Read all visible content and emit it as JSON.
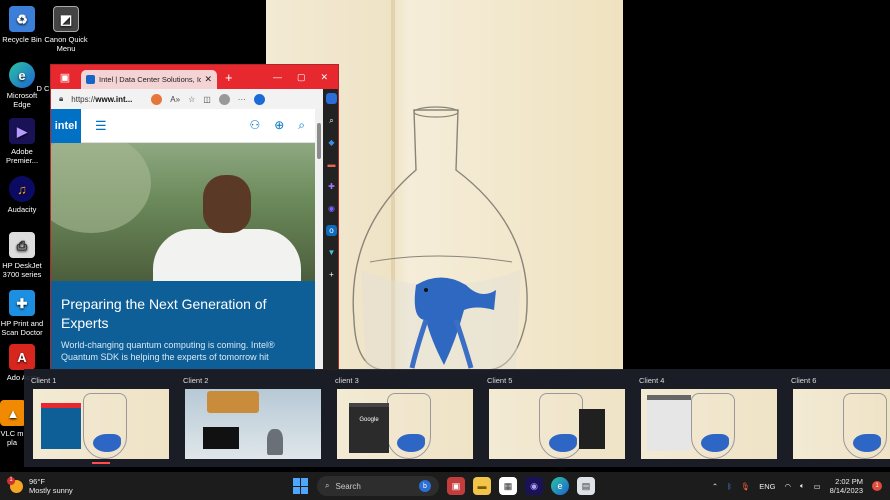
{
  "desktop": {
    "icons": [
      {
        "label": "Recycle Bin",
        "icon": "recycle-bin-icon"
      },
      {
        "label": "Canon Quick Menu",
        "icon": "canon-icon"
      },
      {
        "label": "Microsoft Edge",
        "icon": "edge-icon"
      },
      {
        "label": "Adobe Premier...",
        "icon": "premiere-icon"
      },
      {
        "label": "Audacity",
        "icon": "audacity-icon"
      },
      {
        "label": "HP DeskJet 3700 series",
        "icon": "printer-icon"
      },
      {
        "label": "HP Print and Scan Doctor",
        "icon": "hp-doctor-icon"
      },
      {
        "label": "Ado Acro",
        "icon": "acrobat-icon"
      },
      {
        "label": "VLC m pla",
        "icon": "vlc-icon"
      },
      {
        "label": "D C",
        "icon": "partial-icon"
      }
    ]
  },
  "browser": {
    "tab_title": "Intel | Data Center Solutions, IoT",
    "url_prefix": "https://",
    "url_host": "www.int...",
    "intel_logo": "intel",
    "hero_heading": "Preparing the Next Generation of Experts",
    "hero_body": "World-changing quantum computing is coming. Intel® Quantum SDK is helping the experts of tomorrow hit"
  },
  "switcher": {
    "windows": [
      {
        "label": "Client 1"
      },
      {
        "label": "Client 2"
      },
      {
        "label": "client 3"
      },
      {
        "label": "Client 5"
      },
      {
        "label": "Client 4"
      },
      {
        "label": "Client 6"
      }
    ],
    "client3_preview_text": "Google"
  },
  "taskbar": {
    "weather_temp": "96°F",
    "weather_desc": "Mostly sunny",
    "weather_badge": "1",
    "search_label": "Search",
    "bing_label": "b",
    "lang": "ENG",
    "time": "2:02 PM",
    "date": "8/14/2023",
    "notif_count": "1"
  }
}
